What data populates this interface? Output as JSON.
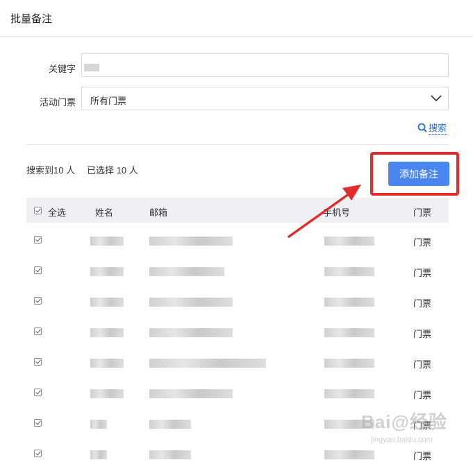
{
  "header": {
    "title": "批量备注"
  },
  "form": {
    "keyword_label": "关键字",
    "ticket_label": "活动门票",
    "ticket_value": "所有门票",
    "search_link": "搜索"
  },
  "summary": {
    "found": "搜索到10 人",
    "selected": "已选择 10 人"
  },
  "add_button": "添加备注",
  "table": {
    "headers": {
      "select_all": "全选",
      "name": "姓名",
      "email": "邮箱",
      "phone": "手机号",
      "ticket": "门票"
    },
    "rows": [
      {
        "checked": true,
        "ticket": "门票"
      },
      {
        "checked": true,
        "ticket": "门票"
      },
      {
        "checked": true,
        "ticket": "门票"
      },
      {
        "checked": true,
        "ticket": "门票"
      },
      {
        "checked": true,
        "ticket": "门票"
      },
      {
        "checked": true,
        "ticket": "门票"
      },
      {
        "checked": true,
        "ticket": "门票"
      },
      {
        "checked": true,
        "ticket": "门票"
      }
    ]
  },
  "watermark": {
    "big": "Bai@经验",
    "small": "jingyan.baidu.com"
  },
  "colors": {
    "accent": "#4a86f0",
    "annotation": "#e42b2b",
    "link": "#2b6fd6"
  }
}
